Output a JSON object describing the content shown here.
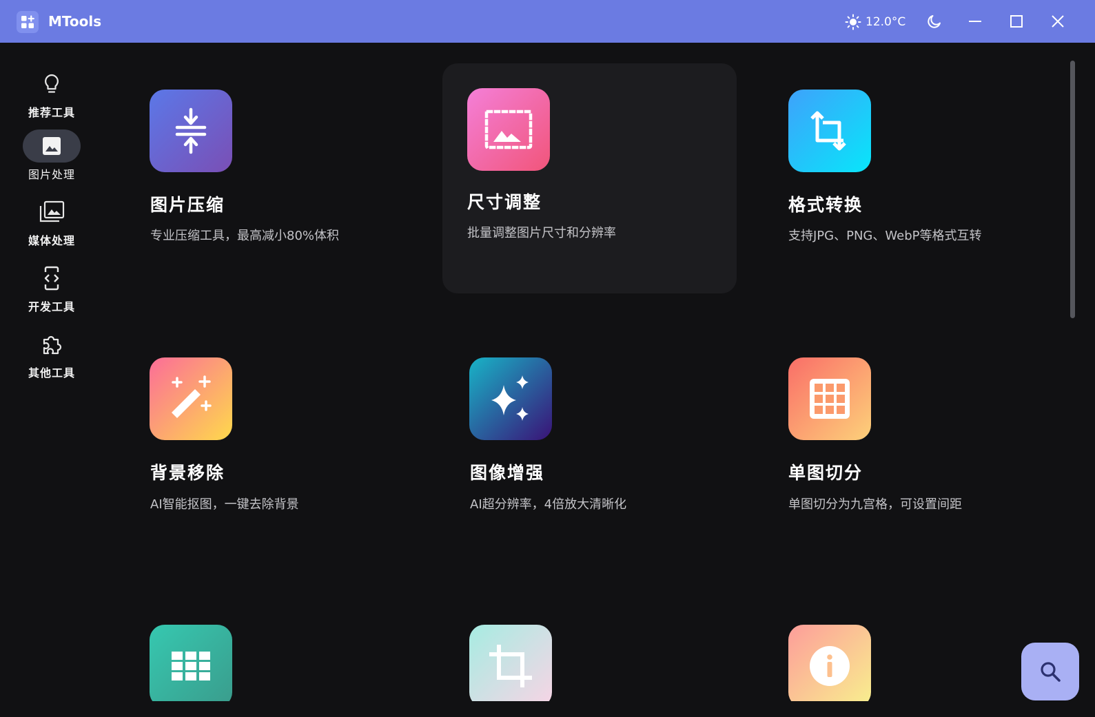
{
  "app": {
    "title": "MTools"
  },
  "titlebar": {
    "temperature": "12.0°C",
    "weather_icon": "sun-icon",
    "theme_icon": "moon-icon",
    "minimize_icon": "minimize-icon",
    "maximize_icon": "maximize-icon",
    "close_icon": "close-icon"
  },
  "sidebar": {
    "items": [
      {
        "label": "推荐工具",
        "icon": "lightbulb-icon",
        "active": false
      },
      {
        "label": "图片处理",
        "icon": "image-icon",
        "active": true
      },
      {
        "label": "媒体处理",
        "icon": "photo-library-icon",
        "active": false
      },
      {
        "label": "开发工具",
        "icon": "code-device-icon",
        "active": false
      },
      {
        "label": "其他工具",
        "icon": "puzzle-icon",
        "active": false
      }
    ],
    "settings_icon": "gear-icon"
  },
  "tools": [
    {
      "title": "图片压缩",
      "desc": "专业压缩工具，最高减小80%体积",
      "icon": "compress-icon",
      "colors": [
        "#5b78e8",
        "#7a4fb5"
      ]
    },
    {
      "title": "尺寸调整",
      "desc": "批量调整图片尺寸和分辨率",
      "icon": "resize-image-icon",
      "colors": [
        "#f47fd8",
        "#f1557a"
      ]
    },
    {
      "title": "格式转换",
      "desc": "支持JPG、PNG、WebP等格式互转",
      "icon": "crop-rotate-icon",
      "colors": [
        "#3ea2fb",
        "#08e6fa"
      ]
    },
    {
      "title": "背景移除",
      "desc": "AI智能抠图，一键去除背景",
      "icon": "magic-wand-icon",
      "colors": [
        "#fb6d98",
        "#fed94c"
      ]
    },
    {
      "title": "图像增强",
      "desc": "AI超分辨率，4倍放大清晰化",
      "icon": "sparkles-icon",
      "colors": [
        "#18b4c7",
        "#3a1277"
      ]
    },
    {
      "title": "单图切分",
      "desc": "单图切分为九宫格，可设置间距",
      "icon": "grid-icon",
      "colors": [
        "#fa6e68",
        "#fdd17a"
      ]
    },
    {
      "title": "",
      "desc": "",
      "icon": "grid-split-icon",
      "colors": [
        "#36c8b0",
        "#3a9c8c"
      ]
    },
    {
      "title": "",
      "desc": "",
      "icon": "crop-icon",
      "colors": [
        "#a6ece2",
        "#f8d4e5"
      ]
    },
    {
      "title": "",
      "desc": "",
      "icon": "info-icon",
      "colors": [
        "#fd9d9a",
        "#f8f08e"
      ]
    }
  ],
  "fab": {
    "icon": "search-icon"
  }
}
